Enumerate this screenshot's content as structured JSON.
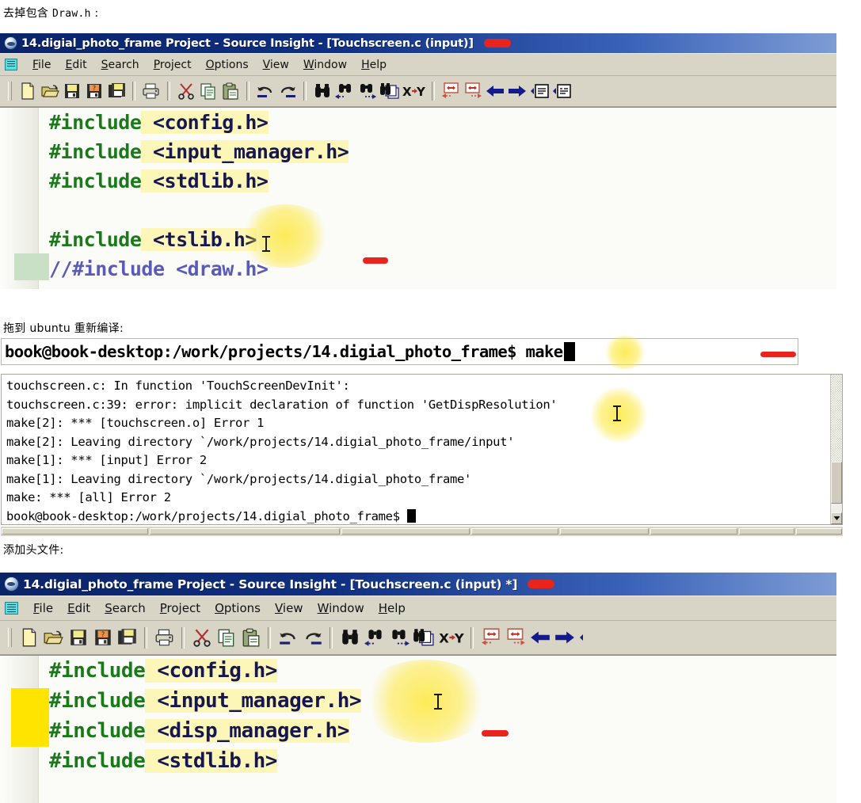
{
  "captions": {
    "c1_prefix": "去掉包含 ",
    "c1_mono": "Draw.h",
    "c1_suffix": " :",
    "c2": "拖到 ubuntu 重新编译:",
    "c3": "添加头文件:"
  },
  "window1": {
    "title": "14.digial_photo_frame Project - Source Insight - [Touchscreen.c (input)]",
    "app_icon": "source-insight-logo",
    "menus": [
      {
        "pre": "",
        "key": "F",
        "post": "ile"
      },
      {
        "pre": "",
        "key": "E",
        "post": "dit"
      },
      {
        "pre": "",
        "key": "S",
        "post": "earch"
      },
      {
        "pre": "",
        "key": "P",
        "post": "roject"
      },
      {
        "pre": "",
        "key": "O",
        "post": "ptions"
      },
      {
        "pre": "",
        "key": "V",
        "post": "iew"
      },
      {
        "pre": "",
        "key": "W",
        "post": "indow"
      },
      {
        "pre": "",
        "key": "H",
        "post": "elp"
      }
    ],
    "toolbar": [
      "new-file-icon",
      "open-folder-icon",
      "save-icon",
      "save-as-icon",
      "save-all-icon",
      "sep",
      "print-icon",
      "sep",
      "cut-scissors-icon",
      "copy-icon",
      "paste-icon",
      "sep",
      "undo-icon",
      "redo-icon",
      "sep",
      "find-binoculars-icon",
      "find-previous-icon",
      "find-next-icon",
      "find-in-files-icon",
      "replace-xy-icon",
      "sep",
      "jump-to-definition-icon",
      "jump-to-declaration-icon",
      "back-arrow-icon",
      "forward-arrow-icon",
      "previous-symbol-icon",
      "next-symbol-icon"
    ],
    "code_lines": [
      {
        "kw": "#include",
        "rest": " <config.h>",
        "highlight": "partial",
        "comment": false
      },
      {
        "kw": "#include",
        "rest": " <input_manager.h>",
        "highlight": "partial",
        "comment": false
      },
      {
        "kw": "#include",
        "rest": " <stdlib.h>",
        "highlight": "partial",
        "comment": false
      },
      {
        "kw": "",
        "rest": "",
        "highlight": "none",
        "comment": false
      },
      {
        "kw": "#include",
        "rest": " <tslib.h>",
        "highlight": "partial",
        "comment": false
      },
      {
        "kw": "",
        "rest": "//#include <draw.h>",
        "highlight": "none",
        "comment": true
      }
    ]
  },
  "terminal": {
    "prompt_line": "book@book-desktop:/work/projects/14.digial_photo_frame$ make",
    "output_lines": [
      "touchscreen.c: In function 'TouchScreenDevInit':",
      "touchscreen.c:39: error: implicit declaration of function 'GetDispResolution'",
      "make[2]: *** [touchscreen.o] Error 1",
      "make[2]: Leaving directory `/work/projects/14.digial_photo_frame/input'",
      "make[1]: *** [input] Error 2",
      "make[1]: Leaving directory `/work/projects/14.digial_photo_frame'",
      "make: *** [all] Error 2"
    ],
    "final_prompt": "book@book-desktop:/work/projects/14.digial_photo_frame$ ",
    "scrollbar": "vertical-scrollbar"
  },
  "window2": {
    "title": "14.digial_photo_frame Project - Source Insight - [Touchscreen.c (input) *]",
    "app_icon": "source-insight-logo",
    "menus": [
      {
        "pre": "",
        "key": "F",
        "post": "ile"
      },
      {
        "pre": "",
        "key": "E",
        "post": "dit"
      },
      {
        "pre": "",
        "key": "S",
        "post": "earch"
      },
      {
        "pre": "",
        "key": "P",
        "post": "roject"
      },
      {
        "pre": "",
        "key": "O",
        "post": "ptions"
      },
      {
        "pre": "",
        "key": "V",
        "post": "iew"
      },
      {
        "pre": "",
        "key": "W",
        "post": "indow"
      },
      {
        "pre": "",
        "key": "H",
        "post": "elp"
      }
    ],
    "code_lines": [
      {
        "kw": "#include",
        "rest": " <config.h>"
      },
      {
        "kw": "#include",
        "rest": " <input_manager.h>"
      },
      {
        "kw": "#include",
        "rest": " <disp_manager.h>"
      },
      {
        "kw": "#include",
        "rest": " <stdlib.h>"
      }
    ]
  },
  "colors": {
    "title_bar": "#0a246a",
    "annotation_red": "#e8241c",
    "highlight_yellow": "#fcf7b8",
    "gutter_yellow": "#ffe400",
    "gutter_green": "#c9e0c6",
    "keyword_green": "#1a7a1a",
    "header_navy": "#17174f",
    "comment_blue": "#5a5ab8",
    "chrome": "#d8d5c7"
  }
}
